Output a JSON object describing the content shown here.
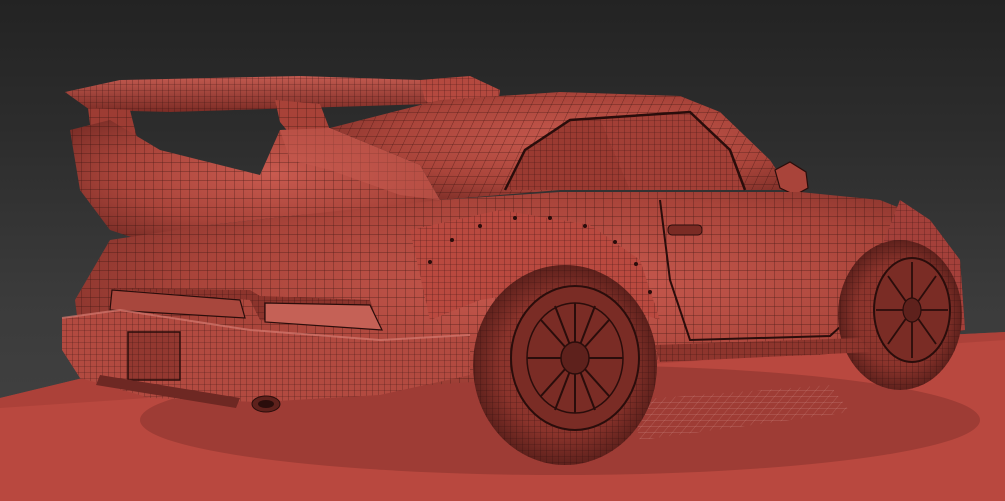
{
  "scene": {
    "background_top_color": "#232323",
    "background_bottom_color": "#454545",
    "ground_color": "#b9483f",
    "mesh_color": "#b24a40",
    "mesh_shadow_color": "#6e2823",
    "wire_color": "#2a0d0b",
    "highlight_color": "#d57a70"
  }
}
